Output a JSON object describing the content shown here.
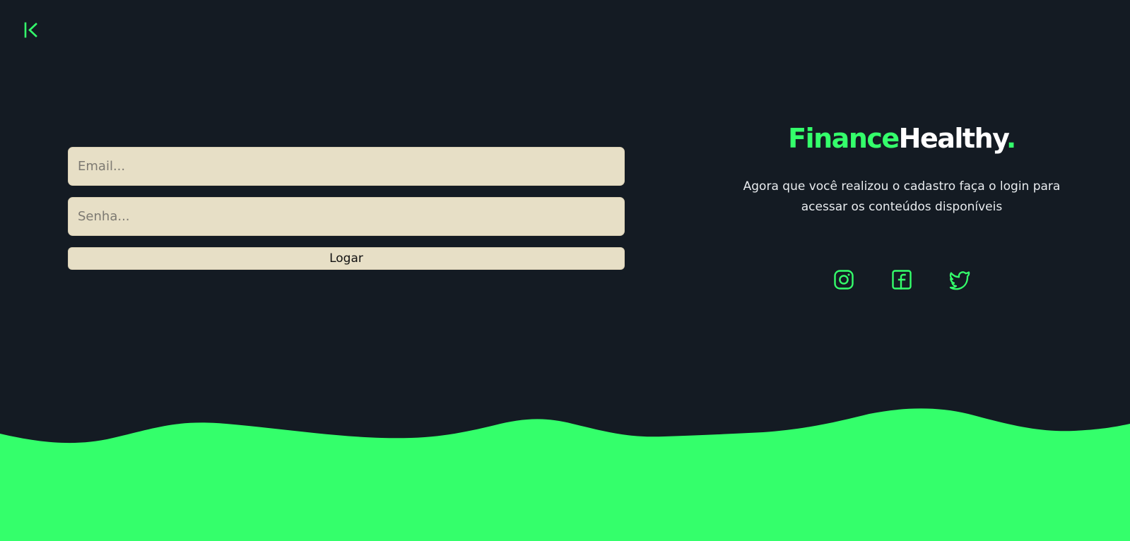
{
  "colors": {
    "background": "#141b23",
    "accent": "#34ff6b",
    "field_background": "#e7dfc6"
  },
  "header": {
    "back_icon": "back-arrow-icon"
  },
  "form": {
    "email_placeholder": "Email...",
    "password_placeholder": "Senha...",
    "submit_label": "Logar"
  },
  "brand": {
    "name_part1": "Finance",
    "name_part2": "Healthy",
    "name_dot": ".",
    "tagline": "Agora que você realizou o cadastro faça o login para acessar os conteúdos disponíveis"
  },
  "socials": [
    {
      "icon": "instagram-icon"
    },
    {
      "icon": "facebook-icon"
    },
    {
      "icon": "twitter-icon"
    }
  ]
}
